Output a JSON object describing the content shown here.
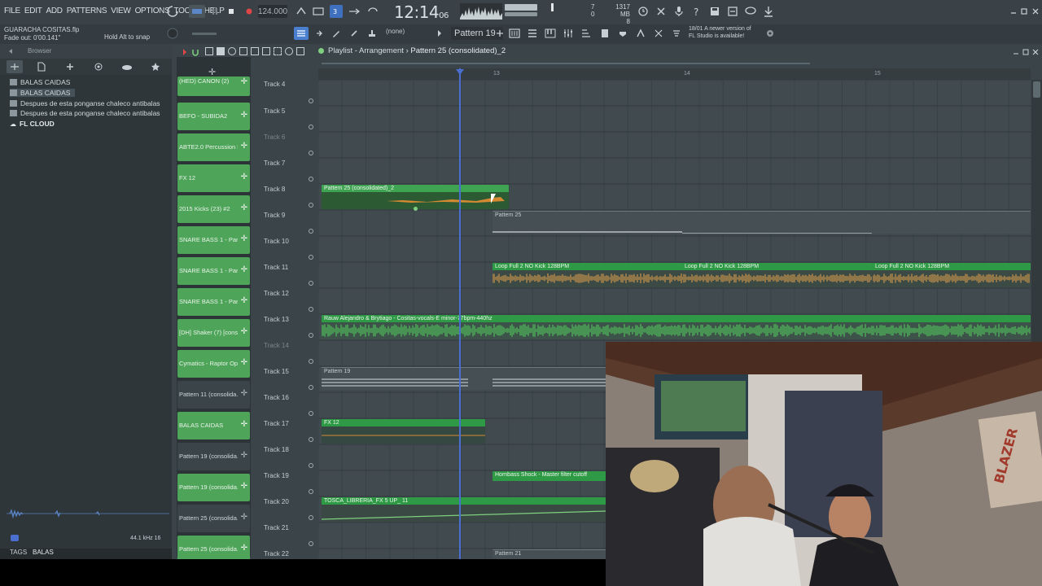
{
  "menu": [
    "FILE",
    "EDIT",
    "ADD",
    "PATTERNS",
    "VIEW",
    "OPTIONS",
    "TOOLS",
    "HELP"
  ],
  "transport": {
    "tempo": "124.000",
    "clock": "12:14",
    "clock_small": "06"
  },
  "system": {
    "mem_value": "1317 MB",
    "mem_sub": "8",
    "count_top": "7",
    "count_bottom": "0"
  },
  "news": {
    "date": "18/01",
    "line1": "A newer version of",
    "line2": "FL Studio is available!"
  },
  "hints": {
    "file": "GUARACHA COSITAS.flp",
    "fade": "Fade out: 0'00.141\"",
    "alt": "Hold Alt to snap"
  },
  "toolbar": {
    "pattern": "Pattern 19",
    "none": "(none)"
  },
  "browser": {
    "title": "Browser",
    "items": [
      {
        "label": "BALAS CAIDAS",
        "bold": false
      },
      {
        "label": "BALAS CAIDAS",
        "bold": false
      },
      {
        "label": "Despues de esta ponganse chaleco antibalas",
        "bold": false
      },
      {
        "label": "Despues de esta ponganse chaleco antibalas",
        "bold": false
      },
      {
        "label": "FL CLOUD",
        "bold": true
      }
    ],
    "samplerate": "44.1 kHz 16",
    "tags_label": "TAGS",
    "tags_value": "BALAS"
  },
  "playlist": {
    "title": "Playlist - Arrangement",
    "pattern": "Pattern 25 (consolidated)_2",
    "ruler": [
      "13",
      "14",
      "15"
    ],
    "patterns": [
      {
        "label": "(HED) CANON (2)",
        "active": true
      },
      {
        "label": "BEFO - SUBIDA2",
        "active": true
      },
      {
        "label": "ABTE2.0 Percussion L...",
        "active": true
      },
      {
        "label": "FX 12",
        "active": true
      },
      {
        "label": "2015 Kicks (23) #2",
        "active": true
      },
      {
        "label": "SNARE BASS 1 - Part_3",
        "active": true
      },
      {
        "label": "SNARE BASS 1 - Part_3",
        "active": true
      },
      {
        "label": "SNARE BASS 1 - Part_...",
        "active": true
      },
      {
        "label": "[DH] Shaker (7) [cons...",
        "active": true
      },
      {
        "label": "Cymatics - Raptor Op...",
        "active": true
      },
      {
        "label": "Pattern 11 (consolida...",
        "active": false
      },
      {
        "label": "BALAS CAIDAS",
        "active": true
      },
      {
        "label": "Pattern 19 (consolida...",
        "active": false
      },
      {
        "label": "Pattern 19 (consolida...",
        "active": true
      },
      {
        "label": "Pattern 25 (consolida...",
        "active": false
      },
      {
        "label": "Pattern 25 (consolida...",
        "active": true
      }
    ],
    "tracks": [
      "Track 4",
      "Track 5",
      "Track 6",
      "Track 7",
      "Track 8",
      "Track 9",
      "Track 10",
      "Track 11",
      "Track 12",
      "Track 13",
      "Track 14",
      "Track 15",
      "Track 16",
      "Track 17",
      "Track 18",
      "Track 19",
      "Track 20",
      "Track 21",
      "Track 22"
    ],
    "clips": {
      "p25c2": "Pattern 25 (consolidated)_2",
      "p25": "Pattern 25",
      "loop1": "Loop Full 2 NO Kick 128BPM",
      "loop2": "Loop Full 2 NO Kick 128BPM",
      "loop3": "Loop Full 2 NO Kick 128BPM",
      "rauw": "Rauw Alejandro & Brytiago - Cositas-vocals-E minor-77bpm-440hz",
      "p19": "Pattern 19",
      "fx12": "FX 12",
      "hornbass": "Hornbass Shock - Master filter cutoff",
      "tosca": "TOSCA_LIBRERIA_FX 5 UP_ 11",
      "p21": "Pattern 21"
    }
  },
  "webcam": {
    "banner": "BLAZER"
  },
  "colors": {
    "accent": "#4ea55a",
    "playhead": "#4a6fd1",
    "background": "#2b3136"
  }
}
